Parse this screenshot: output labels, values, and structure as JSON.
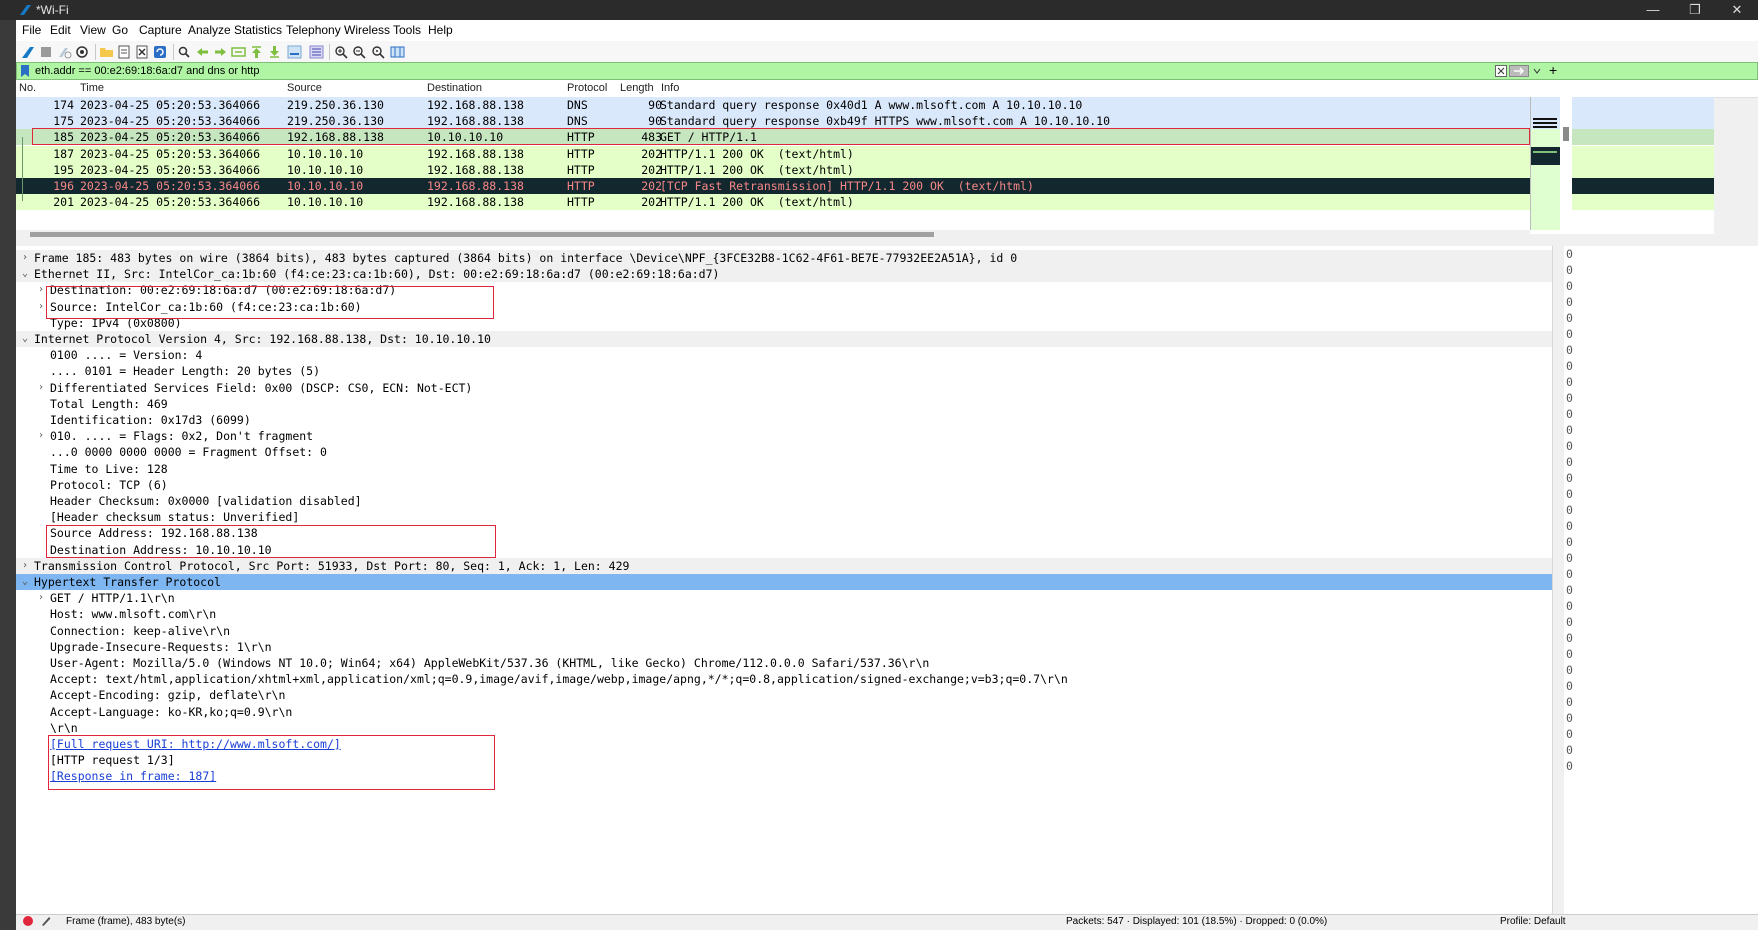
{
  "window": {
    "title": "*Wi-Fi",
    "controls": [
      "—",
      "❐",
      "✕"
    ]
  },
  "menu": [
    "File",
    "Edit",
    "View",
    "Go",
    "Capture",
    "Analyze",
    "Statistics",
    "Telephony",
    "Wireless",
    "Tools",
    "Help"
  ],
  "filter": {
    "value": "eth.addr == 00:e2:69:18:6a:d7 and dns or http",
    "add_button": "+"
  },
  "columns": [
    "No.",
    "Time",
    "Source",
    "Destination",
    "Protocol",
    "Length",
    "Info"
  ],
  "packets": [
    {
      "no": "174",
      "time": "2023-04-25 05:20:53.364066",
      "src": "219.250.36.130",
      "dst": "192.168.88.138",
      "proto": "DNS",
      "len": "90",
      "info": "Standard query response 0x40d1 A www.mlsoft.com A 10.10.10.10",
      "style": "dns"
    },
    {
      "no": "175",
      "time": "2023-04-25 05:20:53.364066",
      "src": "219.250.36.130",
      "dst": "192.168.88.138",
      "proto": "DNS",
      "len": "90",
      "info": "Standard query response 0xb49f HTTPS www.mlsoft.com A 10.10.10.10",
      "style": "dns"
    },
    {
      "no": "185",
      "time": "2023-04-25 05:20:53.364066",
      "src": "192.168.88.138",
      "dst": "10.10.10.10",
      "proto": "HTTP",
      "len": "483",
      "info": "GET / HTTP/1.1",
      "style": "selected"
    },
    {
      "no": "187",
      "time": "2023-04-25 05:20:53.364066",
      "src": "10.10.10.10",
      "dst": "192.168.88.138",
      "proto": "HTTP",
      "len": "202",
      "info": "HTTP/1.1 200 OK  (text/html)",
      "style": "http"
    },
    {
      "no": "195",
      "time": "2023-04-25 05:20:53.364066",
      "src": "10.10.10.10",
      "dst": "192.168.88.138",
      "proto": "HTTP",
      "len": "202",
      "info": "HTTP/1.1 200 OK  (text/html)",
      "style": "http"
    },
    {
      "no": "196",
      "time": "2023-04-25 05:20:53.364066",
      "src": "10.10.10.10",
      "dst": "192.168.88.138",
      "proto": "HTTP",
      "len": "202",
      "info": "[TCP Fast Retransmission] HTTP/1.1 200 OK  (text/html)",
      "style": "bad"
    },
    {
      "no": "201",
      "time": "2023-04-25 05:20:53.364066",
      "src": "10.10.10.10",
      "dst": "192.168.88.138",
      "proto": "HTTP",
      "len": "202",
      "info": "HTTP/1.1 200 OK  (text/html)",
      "style": "http"
    }
  ],
  "details": [
    {
      "indent": 0,
      "arrow": "›",
      "text": "Frame 185: 483 bytes on wire (3864 bits), 483 bytes captured (3864 bits) on interface \\Device\\NPF_{3FCE32B8-1C62-4F61-BE7E-77932EE2A51A}, id 0",
      "style": "section"
    },
    {
      "indent": 0,
      "arrow": "⌄",
      "text": "Ethernet II, Src: IntelCor_ca:1b:60 (f4:ce:23:ca:1b:60), Dst: 00:e2:69:18:6a:d7 (00:e2:69:18:6a:d7)",
      "style": "section"
    },
    {
      "indent": 1,
      "arrow": "›",
      "text": "Destination: 00:e2:69:18:6a:d7 (00:e2:69:18:6a:d7)",
      "style": ""
    },
    {
      "indent": 1,
      "arrow": "›",
      "text": "Source: IntelCor_ca:1b:60 (f4:ce:23:ca:1b:60)",
      "style": ""
    },
    {
      "indent": 1,
      "arrow": "",
      "text": "Type: IPv4 (0x0800)",
      "style": ""
    },
    {
      "indent": 0,
      "arrow": "⌄",
      "text": "Internet Protocol Version 4, Src: 192.168.88.138, Dst: 10.10.10.10",
      "style": "section"
    },
    {
      "indent": 1,
      "arrow": "",
      "text": "0100 .... = Version: 4",
      "style": ""
    },
    {
      "indent": 1,
      "arrow": "",
      "text": ".... 0101 = Header Length: 20 bytes (5)",
      "style": ""
    },
    {
      "indent": 1,
      "arrow": "›",
      "text": "Differentiated Services Field: 0x00 (DSCP: CS0, ECN: Not-ECT)",
      "style": ""
    },
    {
      "indent": 1,
      "arrow": "",
      "text": "Total Length: 469",
      "style": ""
    },
    {
      "indent": 1,
      "arrow": "",
      "text": "Identification: 0x17d3 (6099)",
      "style": ""
    },
    {
      "indent": 1,
      "arrow": "›",
      "text": "010. .... = Flags: 0x2, Don't fragment",
      "style": ""
    },
    {
      "indent": 1,
      "arrow": "",
      "text": "...0 0000 0000 0000 = Fragment Offset: 0",
      "style": ""
    },
    {
      "indent": 1,
      "arrow": "",
      "text": "Time to Live: 128",
      "style": ""
    },
    {
      "indent": 1,
      "arrow": "",
      "text": "Protocol: TCP (6)",
      "style": ""
    },
    {
      "indent": 1,
      "arrow": "",
      "text": "Header Checksum: 0x0000 [validation disabled]",
      "style": ""
    },
    {
      "indent": 1,
      "arrow": "",
      "text": "[Header checksum status: Unverified]",
      "style": ""
    },
    {
      "indent": 1,
      "arrow": "",
      "text": "Source Address: 192.168.88.138",
      "style": ""
    },
    {
      "indent": 1,
      "arrow": "",
      "text": "Destination Address: 10.10.10.10",
      "style": ""
    },
    {
      "indent": 0,
      "arrow": "›",
      "text": "Transmission Control Protocol, Src Port: 51933, Dst Port: 80, Seq: 1, Ack: 1, Len: 429",
      "style": "section"
    },
    {
      "indent": 0,
      "arrow": "⌄",
      "text": "Hypertext Transfer Protocol",
      "style": "selected"
    },
    {
      "indent": 1,
      "arrow": "›",
      "text": "GET / HTTP/1.1\\r\\n",
      "style": ""
    },
    {
      "indent": 1,
      "arrow": "",
      "text": "Host: www.mlsoft.com\\r\\n",
      "style": ""
    },
    {
      "indent": 1,
      "arrow": "",
      "text": "Connection: keep-alive\\r\\n",
      "style": ""
    },
    {
      "indent": 1,
      "arrow": "",
      "text": "Upgrade-Insecure-Requests: 1\\r\\n",
      "style": ""
    },
    {
      "indent": 1,
      "arrow": "",
      "text": "User-Agent: Mozilla/5.0 (Windows NT 10.0; Win64; x64) AppleWebKit/537.36 (KHTML, like Gecko) Chrome/112.0.0.0 Safari/537.36\\r\\n",
      "style": ""
    },
    {
      "indent": 1,
      "arrow": "",
      "text": "Accept: text/html,application/xhtml+xml,application/xml;q=0.9,image/avif,image/webp,image/apng,*/*;q=0.8,application/signed-exchange;v=b3;q=0.7\\r\\n",
      "style": ""
    },
    {
      "indent": 1,
      "arrow": "",
      "text": "Accept-Encoding: gzip, deflate\\r\\n",
      "style": ""
    },
    {
      "indent": 1,
      "arrow": "",
      "text": "Accept-Language: ko-KR,ko;q=0.9\\r\\n",
      "style": ""
    },
    {
      "indent": 1,
      "arrow": "",
      "text": "\\r\\n",
      "style": ""
    },
    {
      "indent": 1,
      "arrow": "",
      "text": "[Full request URI: http://www.mlsoft.com/]",
      "style": "link"
    },
    {
      "indent": 1,
      "arrow": "",
      "text": "[HTTP request 1/3]",
      "style": ""
    },
    {
      "indent": 1,
      "arrow": "",
      "text": "[Response in frame: 187]",
      "style": "link"
    }
  ],
  "status": {
    "left": "Frame (frame), 483 byte(s)",
    "center": "Packets: 547 · Displayed: 101 (18.5%) · Dropped: 0 (0.0%)",
    "right": "Profile: Default"
  },
  "colors": {
    "dns": "#dae8fc",
    "http": "#e4ffc7",
    "selected_packet": "#c6e6c0",
    "bad_bg": "#12272e",
    "bad_fg": "#f78787",
    "section_bg": "#f0f0f0",
    "selected_detail": "#7eb6f2",
    "highlight_box": "#e0263a"
  }
}
